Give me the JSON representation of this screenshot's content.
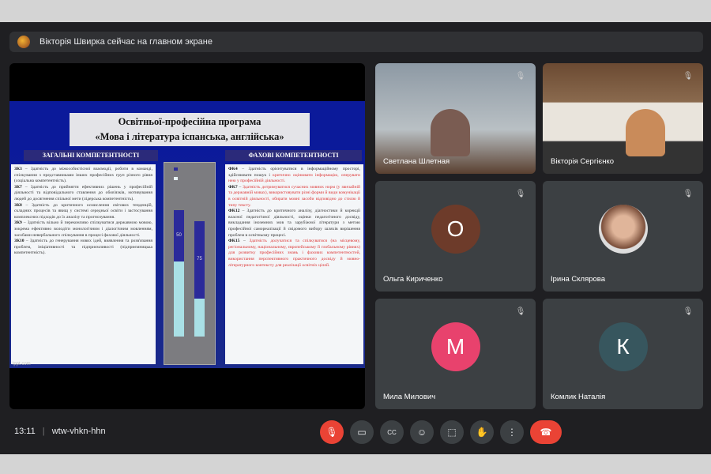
{
  "banner": {
    "text": "Вікторія Швирка сейчас на главном экране"
  },
  "slide": {
    "title_line1": "Освітньої-професійна програма",
    "title_line2": "«Мова і література іспанська, англійська»",
    "left_header": "ЗАГАЛЬНІ КОМПЕТЕНТНОСТІ",
    "right_header": "ФАХОВІ КОМПЕТЕНТНОСТІ",
    "left_items": [
      {
        "code": "ЗК3",
        "text": " – Здатність до міжособистісної взаємодії, роботи в команді, спілкування з представниками інших професійних груп різного рівня (соціальна компетентність)."
      },
      {
        "code": "ЗК7",
        "text": " – Здатність до прийняття ефективних рішень у професійній діяльності та відповідального ставлення до обов'язків, мотивування людей до досягнення спільної мети (лідерська компетентність)."
      },
      {
        "code": "ЗК8",
        "text": " – Здатність до критичного осмислення світових тенденцій, складних процесів та явищ у системі середньої освіти і застосування комплексних підходів до їх аналізу та прогнозування."
      },
      {
        "code": "ЗК9",
        "text": " – Здатність вільно й переконливо спілкуватися державною мовою, зокрема ефективно володіти монологічним і діалогічним мовленням, засобами невербального спілкування в процесі фахової діяльності."
      },
      {
        "code": "ЗК10",
        "text": " – Здатність до генерування нових ідей, виявлення та розв'язання проблем, ініціативності та підприємливості (підприємницька компетентність)."
      }
    ],
    "right_items": [
      {
        "code": "ФК4",
        "text": " – Здатність орієнтуватися в інформаційному просторі, здійснювати пошук і ",
        "red": "критично оцінювати інформацію, оперувати нею у професійній діяльності."
      },
      {
        "code": "ФК7",
        "text": " – ",
        "red": "Здатність дотримуватися сучасних мовних норм (у звичайній та державній мовах), використовувати різні форми й види комунікації в освітній діяльності, обирати мовні засоби відповідно до стилю й типу тексту."
      },
      {
        "code": "ФК12",
        "text": " – Здатність до критичного аналізу, діагностики й корекції власної педагогічної діяльності, оцінки педагогічного досвіду, викладання іноземних мов та зарубіжної літератури з метою професійної самореалізації й свідомого вибору шляхів вирішення проблем в освітньому процесі.",
        "red": ""
      },
      {
        "code": "ФК15",
        "text": " – ",
        "red": "Здатність долучатися та спілкуватися (на місцевому, регіональному, національному, європейському й глобальному рівнях) для розвитку професійних знань і фахових компетентностей, використання перспективного практичного досвіду й мовно-літературного контексту для реалізації освітніх цілей."
      }
    ],
    "footer": "lppt.com",
    "chart_data": {
      "type": "bar",
      "stacked": true,
      "series_colors": [
        "#2b2a9a",
        "#a9e0e6"
      ],
      "bar_labels": [
        "50",
        "75"
      ],
      "top_values": [
        50,
        75
      ]
    }
  },
  "participants": [
    {
      "name": "Светлана Шлетная",
      "video": true,
      "muted": true
    },
    {
      "name": "Вікторія Сергієнко",
      "video": true,
      "muted": true
    },
    {
      "name": "Ольга Кириченко",
      "initial": "О",
      "color": "#6d3b2a",
      "muted": true
    },
    {
      "name": "Ірина Склярова",
      "photo": true,
      "muted": true
    },
    {
      "name": "Мила Милович",
      "initial": "М",
      "color": "#e8426d",
      "muted": true
    },
    {
      "name": "Комлик Наталія",
      "initial": "К",
      "color": "#37565e",
      "muted": true
    }
  ],
  "bottom": {
    "time": "13:11",
    "separator": "|",
    "meeting_code": "wtw-vhkn-hhn"
  },
  "controls": {
    "mic": "🎙",
    "camera": "▭",
    "captions": "CC",
    "emoji": "☺",
    "present": "⬚",
    "hand": "✋",
    "more": "⋮",
    "end": "☎"
  }
}
